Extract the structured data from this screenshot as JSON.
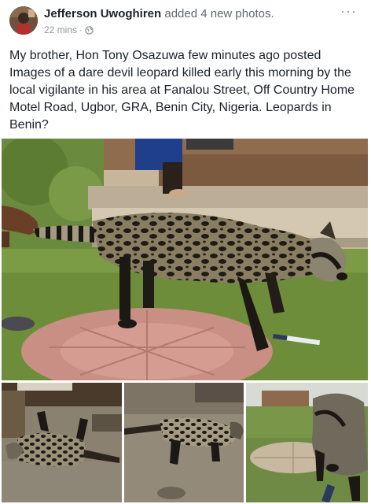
{
  "post": {
    "author": "Jefferson Uwoghiren",
    "action": "added 4 new photos.",
    "time": "22 mins",
    "separator": "·",
    "menu": "···",
    "text": "My brother, Hon Tony Osazuwa few minutes ago posted Images of a dare devil leopard killed early this morning by the local vigilante in his area at Fanalou Street, Off Country Home Motel Road, Ugbor, GRA, Benin City, Nigeria. Leopards in Benin?"
  },
  "icons": {
    "globe": "globe-icon",
    "menu": "more-options-icon"
  },
  "colors": {
    "author": "#1d2129",
    "meta": "#90949c",
    "background": "#ffffff"
  }
}
